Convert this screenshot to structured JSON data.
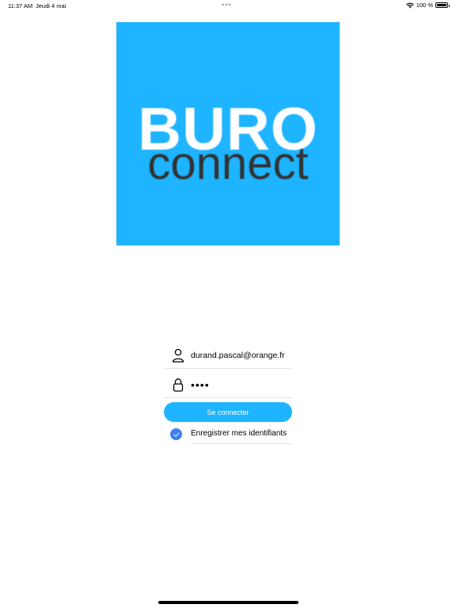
{
  "status_bar": {
    "time": "11:37 AM",
    "date": "Jeudi 4 mai",
    "dots": "•••",
    "battery_text": "100 %",
    "wifi_icon": "wifi-icon",
    "battery_icon": "battery-icon"
  },
  "logo": {
    "line1": "BURO",
    "line2": "connect"
  },
  "login_form": {
    "email_value": "durand.pascal@orange.fr",
    "email_icon": "user-icon",
    "password_value": "••••",
    "password_icon": "lock-icon",
    "submit_label": "Se connecter",
    "remember_label": "Enregistrer mes identifiants",
    "remember_checked": true
  },
  "colors": {
    "brand": "#1eb4ff",
    "logo_text_dark": "#333333",
    "checkbox": "#3b7ff2",
    "divider": "#e3e3e3"
  }
}
